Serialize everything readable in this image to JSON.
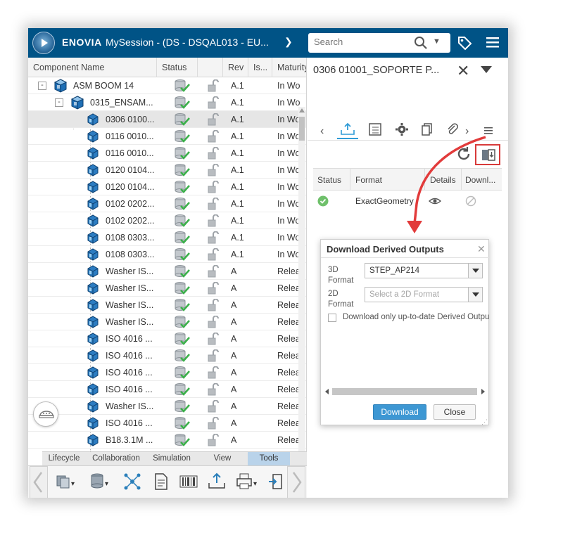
{
  "topbar": {
    "brand": "ENOVIA",
    "session_title": "MySession - (DS - DSQAL013 - EU...",
    "search_placeholder": "Search"
  },
  "tree": {
    "columns": [
      "Component Name",
      "Status",
      "",
      "Rev",
      "Is...",
      "Maturity"
    ],
    "rows": [
      {
        "name": "ASM BOOM 14",
        "rev": "A.1",
        "maturity": "In Wo",
        "level": 0,
        "type": "assembly",
        "expander": "-"
      },
      {
        "name": "0315_ENSAM...",
        "rev": "A.1",
        "maturity": "In Wo",
        "level": 1,
        "type": "assembly",
        "expander": "-"
      },
      {
        "name": "0306 0100...",
        "rev": "A.1",
        "maturity": "In Wo",
        "level": 2,
        "type": "part",
        "selected": true
      },
      {
        "name": "0116 0010...",
        "rev": "A.1",
        "maturity": "In Wo",
        "level": 2,
        "type": "part"
      },
      {
        "name": "0116 0010...",
        "rev": "A.1",
        "maturity": "In Wo",
        "level": 2,
        "type": "part"
      },
      {
        "name": "0120 0104...",
        "rev": "A.1",
        "maturity": "In Wo",
        "level": 2,
        "type": "part"
      },
      {
        "name": "0120 0104...",
        "rev": "A.1",
        "maturity": "In Wo",
        "level": 2,
        "type": "part"
      },
      {
        "name": "0102 0202...",
        "rev": "A.1",
        "maturity": "In Wo",
        "level": 2,
        "type": "part"
      },
      {
        "name": "0102 0202...",
        "rev": "A.1",
        "maturity": "In Wo",
        "level": 2,
        "type": "part"
      },
      {
        "name": "0108 0303...",
        "rev": "A.1",
        "maturity": "In Wo",
        "level": 2,
        "type": "part"
      },
      {
        "name": "0108 0303...",
        "rev": "A.1",
        "maturity": "In Wo",
        "level": 2,
        "type": "part"
      },
      {
        "name": "Washer IS...",
        "rev": "A",
        "maturity": "Relea",
        "level": 2,
        "type": "part"
      },
      {
        "name": "Washer IS...",
        "rev": "A",
        "maturity": "Relea",
        "level": 2,
        "type": "part"
      },
      {
        "name": "Washer IS...",
        "rev": "A",
        "maturity": "Relea",
        "level": 2,
        "type": "part"
      },
      {
        "name": "Washer IS...",
        "rev": "A",
        "maturity": "Relea",
        "level": 2,
        "type": "part"
      },
      {
        "name": "ISO 4016 ...",
        "rev": "A",
        "maturity": "Relea",
        "level": 2,
        "type": "part"
      },
      {
        "name": "ISO 4016 ...",
        "rev": "A",
        "maturity": "Relea",
        "level": 2,
        "type": "part"
      },
      {
        "name": "ISO 4016 ...",
        "rev": "A",
        "maturity": "Relea",
        "level": 2,
        "type": "part"
      },
      {
        "name": "ISO 4016 ...",
        "rev": "A",
        "maturity": "Relea",
        "level": 2,
        "type": "part"
      },
      {
        "name": "Washer IS...",
        "rev": "A",
        "maturity": "Relea",
        "level": 2,
        "type": "part"
      },
      {
        "name": "ISO 4016 ...",
        "rev": "A",
        "maturity": "Relea",
        "level": 2,
        "type": "part"
      },
      {
        "name": "B18.3.1M ...",
        "rev": "A",
        "maturity": "Relea",
        "level": 2,
        "type": "part"
      }
    ]
  },
  "action_bar": {
    "tabs": [
      "Lifecycle",
      "Collaboration",
      "Simulation",
      "View",
      "Tools"
    ],
    "active_tab": "Tools"
  },
  "panel": {
    "title": "0306 01001_SOPORTE P...",
    "outputs_table": {
      "columns": [
        "Status",
        "Format",
        "Details",
        "Downl..."
      ],
      "rows": [
        {
          "format": "ExactGeometry"
        }
      ]
    }
  },
  "dialog": {
    "title": "Download Derived Outputs",
    "format3d_label": "3D Format",
    "format3d_value": "STEP_AP214",
    "format2d_label": "2D Format",
    "format2d_placeholder": "Select a 2D Format",
    "checkbox_label": "Download only up-to-date Derived Outputs",
    "download_label": "Download",
    "close_label": "Close"
  },
  "colors": {
    "topbar": "#005386",
    "accent_blue": "#3d97d3",
    "status_green": "#5cb85c",
    "callout_red": "#e23b3b"
  }
}
